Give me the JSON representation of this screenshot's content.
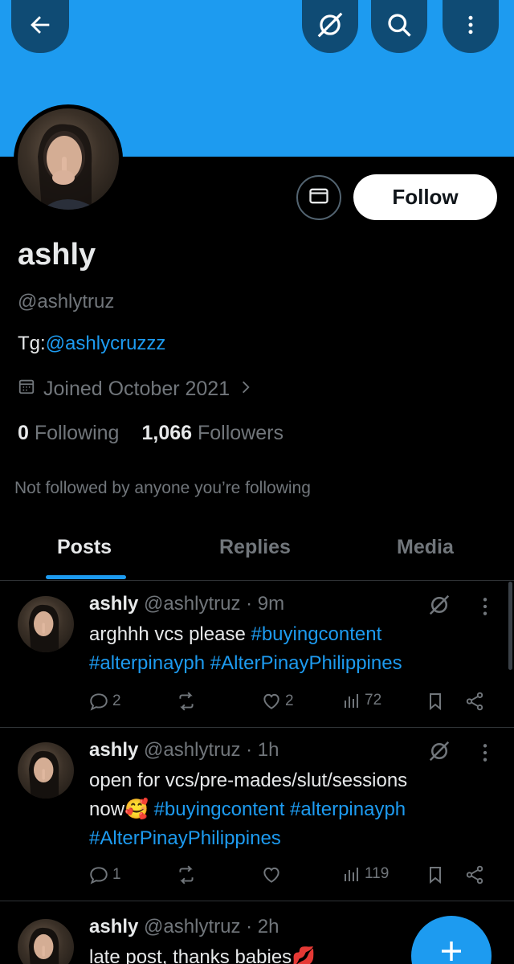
{
  "profile": {
    "name": "ashly",
    "handle": "@ashlytruz",
    "bio_prefix": "Tg:",
    "bio_link": "@ashlycruzzz",
    "joined": "Joined October 2021",
    "following_count": "0",
    "following_label": "Following",
    "followers_count": "1,066",
    "followers_label": "Followers",
    "not_followed": "Not followed by anyone you’re following",
    "follow_label": "Follow"
  },
  "header": {
    "icons": [
      "arrow-left-icon",
      "grok-icon",
      "search-icon",
      "more-vertical-icon"
    ]
  },
  "tabs": [
    {
      "label": "Posts",
      "active": true
    },
    {
      "label": "Replies",
      "active": false
    },
    {
      "label": "Media",
      "active": false
    }
  ],
  "posts": [
    {
      "name": "ashly",
      "handle": "@ashlytruz",
      "time": "· 9m",
      "line1": "arghhh vcs please ",
      "tag1": "#buyingcontent",
      "tag2": "#alterpinayph",
      "tag3": "#AlterPinayPhilippines",
      "replies": "2",
      "reposts": "",
      "likes": "2",
      "views": "72"
    },
    {
      "name": "ashly",
      "handle": "@ashlytruz",
      "time": "· 1h",
      "line1": "open for vcs/pre-mades/slut/sessions",
      "line2": "now🥰 ",
      "tag1": "#buyingcontent",
      "tag2": "#alterpinayph",
      "tag3": "#AlterPinayPhilippines",
      "replies": "1",
      "reposts": "",
      "likes": "",
      "views": "119"
    },
    {
      "name": "ashly",
      "handle": "@ashlytruz",
      "time": "· 2h",
      "line1": "late post, thanks babies💋"
    }
  ],
  "colors": {
    "accent": "#1d9bf0",
    "banner": "#1d9bf0",
    "background": "#000000",
    "muted": "#71767b"
  }
}
